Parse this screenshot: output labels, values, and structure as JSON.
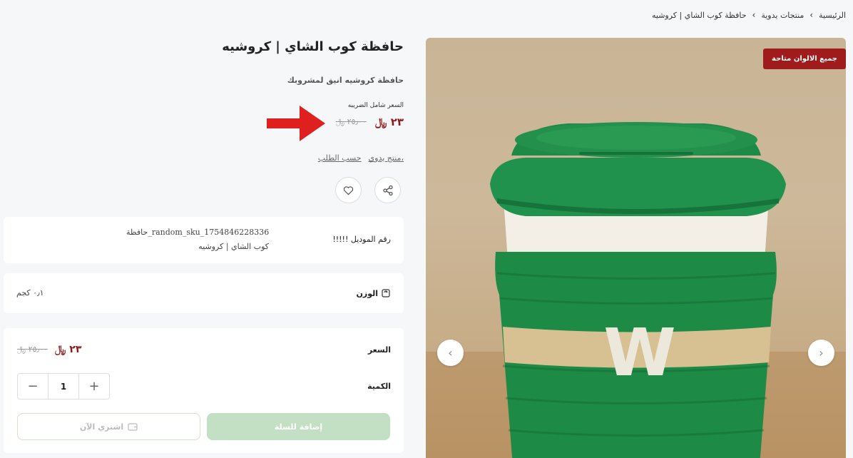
{
  "breadcrumb": {
    "home": "الرئيسية",
    "category": "منتجات يدوية",
    "current": "حافظة كوب الشاي | كروشيه",
    "separator": "‹"
  },
  "product": {
    "title": "حافظة كوب الشاي | كروشيه",
    "subtitle": "حافظة كروشيه انيق لمشروبك",
    "price_note": "السعر شامل الضريبه",
    "price_current": "٢٣ ﷼",
    "price_old": "٢٥٫٠٠ ﷼",
    "tags": [
      "منتج يدوي،",
      "حسب الطلب"
    ]
  },
  "gallery": {
    "badge": "جميع الالوان متاحة",
    "prev_icon": "chevron-left-icon",
    "next_icon": "chevron-right-icon",
    "cup_letter": "W"
  },
  "actions": {
    "share_icon": "share-icon",
    "favorite_icon": "heart-icon"
  },
  "model": {
    "label": "!!!!! رقم الموديل",
    "value_line1": "حافظة_random_sku_1754846228336",
    "value_line2": "كوب الشاي | كروشيه"
  },
  "weight": {
    "label": "الوزن",
    "icon": "scale-icon",
    "value": "٠٫١ كجم"
  },
  "purchase": {
    "price_label": "السعر",
    "price_current": "٢٣ ﷼",
    "price_old": "٢٥٫٠٠ ﷼",
    "quantity_label": "الكمية",
    "quantity": "1",
    "minus": "−",
    "plus": "+",
    "add_to_cart": "إضافة للسلة",
    "buy_now": "اشتري الآن",
    "buy_icon": "wallet-icon"
  },
  "colors": {
    "accent_red": "#8e1b1b",
    "badge_red": "#a01c1c",
    "button_green": "#c3dfc4",
    "cup_green": "#1c8b46"
  }
}
